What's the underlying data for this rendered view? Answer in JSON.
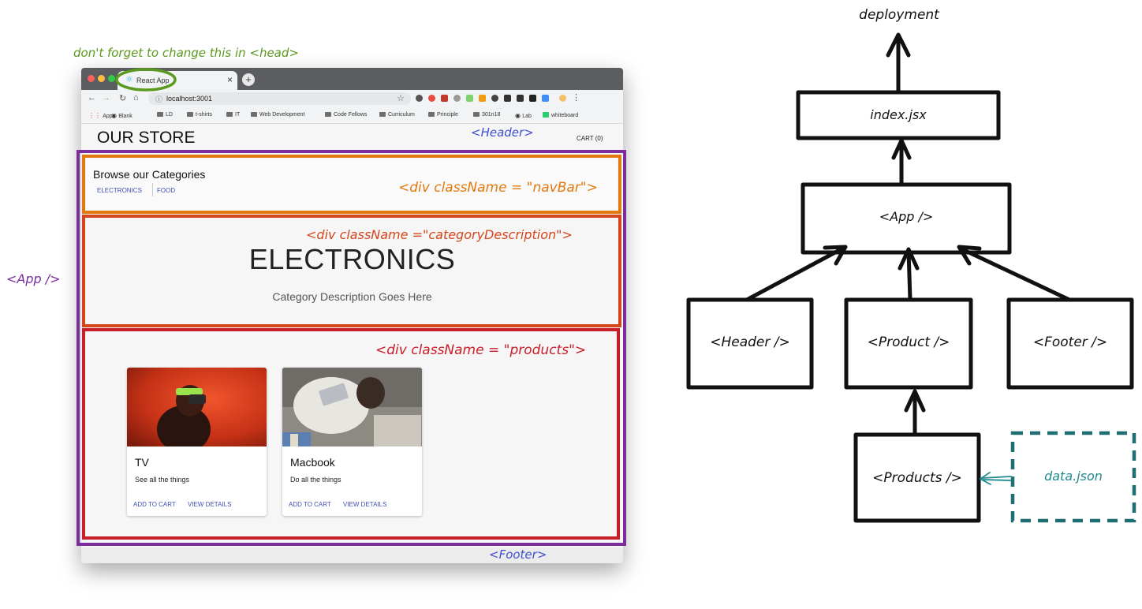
{
  "annotations": {
    "head_note": "don't forget to change this in <head>",
    "app": "<App />",
    "header": "<Header>",
    "navbar": "<div className = \"navBar\">",
    "category_description": "<div className =\"categoryDescription\">",
    "products": "<div className = \"products\">",
    "footer": "<Footer>"
  },
  "browser": {
    "tab_title": "React App",
    "tab_close": "×",
    "new_tab": "+",
    "url": "localhost:3001",
    "bookmarks": [
      "Apps",
      "Blank",
      "LD",
      "t-shirts",
      "IT",
      "Web Development",
      "Code Fellows",
      "Curriculum",
      "Principle",
      "301n18",
      "Lab",
      "whiteboard"
    ]
  },
  "page": {
    "store_title": "OUR STORE",
    "cart": "CART (0)",
    "browse_title": "Browse our Categories",
    "categories": [
      "ELECTRONICS",
      "FOOD"
    ],
    "category_heading": "ELECTRONICS",
    "category_description": "Category Description Goes Here",
    "products": [
      {
        "name": "TV",
        "description": "See all the things",
        "add_label": "ADD TO CART",
        "view_label": "VIEW DETAILS"
      },
      {
        "name": "Macbook",
        "description": "Do all the things",
        "add_label": "ADD TO CART",
        "view_label": "VIEW DETAILS"
      }
    ]
  },
  "diagram": {
    "deployment": "deployment",
    "index": "index.jsx",
    "app": "<App />",
    "header": "<Header />",
    "product": "<Product />",
    "footer": "<Footer />",
    "products": "<Products />",
    "data": "data.json"
  },
  "colors": {
    "link_blue": "#3f51b5",
    "annotation_green": "#5a9a1e",
    "annotation_purple": "#7b2d9b",
    "annotation_blue": "#3e4fd1",
    "annotation_orange": "#e2790f",
    "annotation_red_orange": "#d5451b",
    "annotation_red": "#c81e2a",
    "data_teal": "#1f8b8e"
  }
}
